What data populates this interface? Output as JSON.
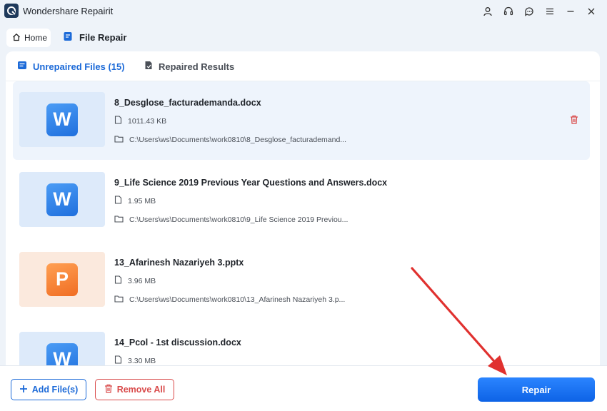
{
  "app": {
    "title": "Wondershare Repairit",
    "logo_icon": "repairit-logo-icon"
  },
  "window_controls": [
    {
      "name": "account-icon"
    },
    {
      "name": "headset-support-icon"
    },
    {
      "name": "feedback-chat-icon"
    },
    {
      "name": "menu-icon"
    },
    {
      "name": "minimize-icon"
    },
    {
      "name": "close-icon"
    }
  ],
  "nav": {
    "home_label": "Home",
    "current_label": "File Repair"
  },
  "tabs": {
    "unrepaired_label": "Unrepaired Files (15)",
    "repaired_label": "Repaired Results"
  },
  "files": [
    {
      "type": "docx",
      "badge": "W",
      "name": "8_Desglose_facturademanda.docx",
      "size": "1011.43 KB",
      "path": "C:\\Users\\ws\\Documents\\work0810\\8_Desglose_facturademand...",
      "selected": true
    },
    {
      "type": "docx",
      "badge": "W",
      "name": "9_Life Science 2019 Previous Year Questions and Answers.docx",
      "size": "1.95 MB",
      "path": "C:\\Users\\ws\\Documents\\work0810\\9_Life Science 2019 Previou...",
      "selected": false
    },
    {
      "type": "pptx",
      "badge": "P",
      "name": "13_Afarinesh Nazariyeh 3.pptx",
      "size": "3.96 MB",
      "path": "C:\\Users\\ws\\Documents\\work0810\\13_Afarinesh Nazariyeh 3.p...",
      "selected": false
    },
    {
      "type": "docx",
      "badge": "W",
      "name": "14_Pcol - 1st discussion.docx",
      "size": "3.30 MB",
      "path": "",
      "selected": false
    }
  ],
  "bottom": {
    "add_label": "Add File(s)",
    "remove_label": "Remove All",
    "repair_label": "Repair"
  },
  "colors": {
    "accent": "#1c6ad8",
    "danger": "#d94a4a",
    "annotation_arrow": "#e0312f"
  }
}
